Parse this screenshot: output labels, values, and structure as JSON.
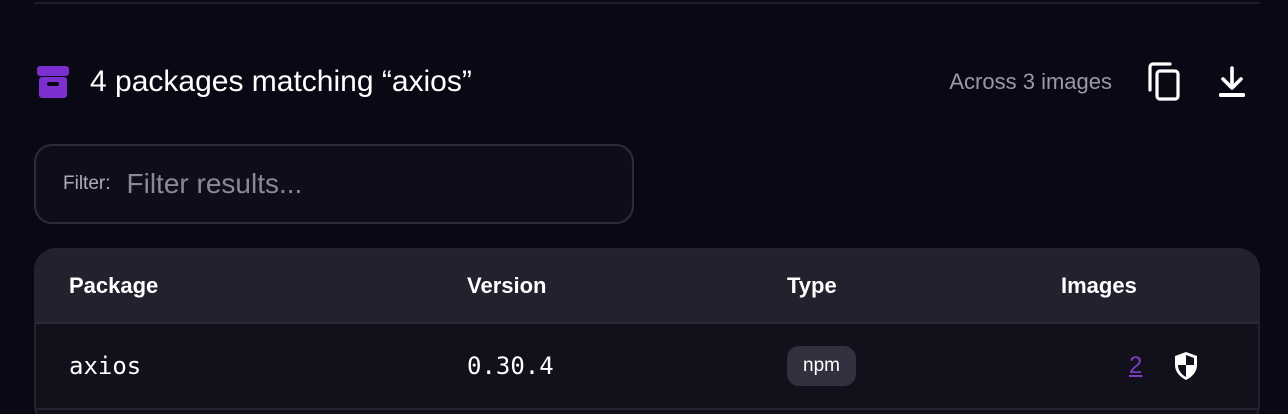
{
  "header": {
    "title": "4 packages matching “axios”",
    "meta": "Across 3 images",
    "icons": {
      "archive": "archive-icon",
      "copy": "copy-icon",
      "download": "download-icon"
    },
    "accent_color": "#7b2fd0"
  },
  "filter": {
    "label": "Filter:",
    "placeholder": "Filter results...",
    "value": ""
  },
  "table": {
    "columns": [
      "Package",
      "Version",
      "Type",
      "Images"
    ],
    "rows": [
      {
        "package": "axios",
        "version": "0.30.4",
        "type": "npm",
        "images": "2",
        "status_icon": "shield-icon"
      }
    ]
  }
}
